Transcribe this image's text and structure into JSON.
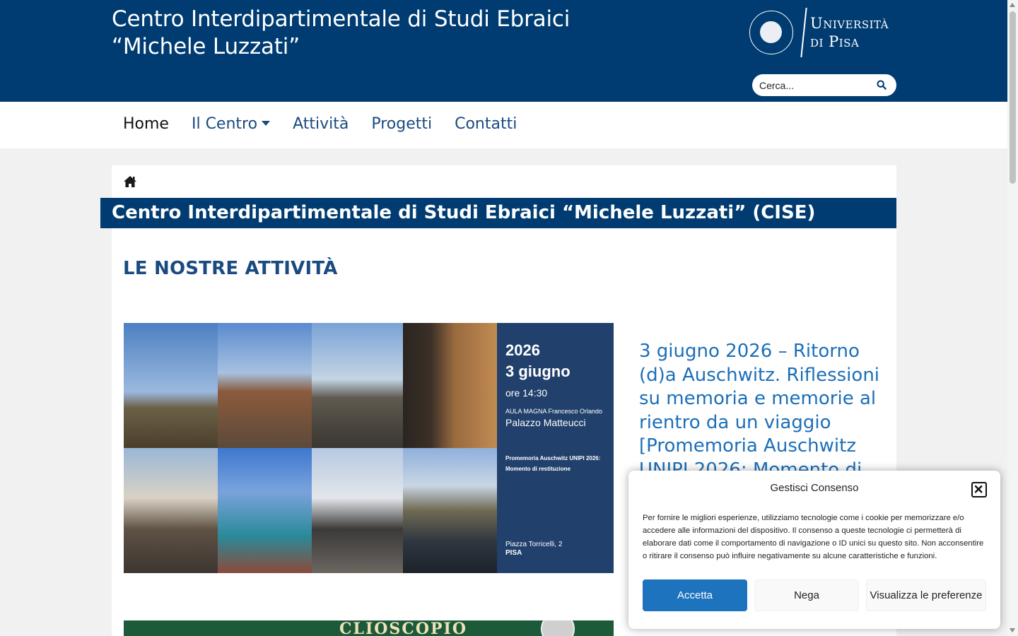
{
  "header": {
    "site_title": "Centro Interdipartimentale di Studi Ebraici “Michele Luzzati”",
    "logo_line1": "Università",
    "logo_line2": "di Pisa",
    "search_placeholder": "Cerca..."
  },
  "nav": {
    "items": [
      {
        "label": "Home",
        "active": true
      },
      {
        "label": "Il Centro",
        "dropdown": true
      },
      {
        "label": "Attività"
      },
      {
        "label": "Progetti"
      },
      {
        "label": "Contatti"
      }
    ]
  },
  "page": {
    "banner_title": "Centro Interdipartimentale di Studi Ebraici “Michele Luzzati” (CISE)",
    "section_heading": "LE NOSTRE ATTIVITÀ"
  },
  "article": {
    "title": "3 giugno 2026 – Ritorno (d)a Auschwitz. Riflessioni su memoria e memorie al rientro da un viaggio [Promemoria Auschwitz UNIPI 2026: Momento di restituzione]",
    "poster": {
      "year": "2026",
      "date": "3 giugno",
      "time": "ore 14:30",
      "aula": "AULA MAGNA Francesco Orlando",
      "palazzo": "Palazzo Matteucci",
      "promemoria": "Promemoria Auschwitz UNIPI 2026: Momento di restituzione",
      "address": "Piazza Torricelli, 2",
      "city": "PISA"
    }
  },
  "article2": {
    "poster_text": "CLIOSCOPIO"
  },
  "consent": {
    "title": "Gestisci Consenso",
    "text": "Per fornire le migliori esperienze, utilizziamo tecnologie come i cookie per memorizzare e/o accedere alle informazioni del dispositivo. Il consenso a queste tecnologie ci permetterà di elaborare dati come il comportamento di navigazione o ID unici su questo sito. Non acconsentire o ritirare il consenso può influire negativamente su alcune caratteristiche e funzioni.",
    "accept": "Accetta",
    "deny": "Nega",
    "preferences": "Visualizza le preferenze"
  },
  "colors": {
    "brand": "#003c71",
    "link": "#1c6fb8",
    "accept_button": "#1e73be"
  }
}
